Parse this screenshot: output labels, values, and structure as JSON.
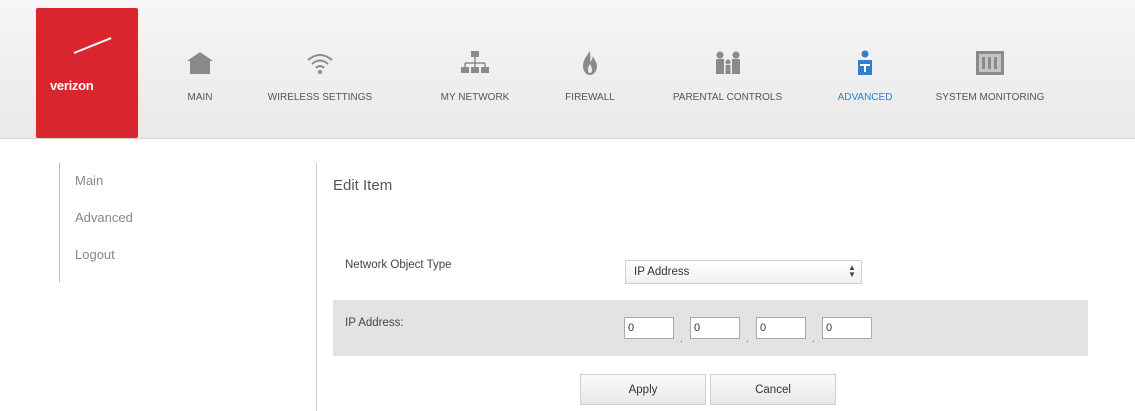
{
  "brand": {
    "logo_text": "verizon",
    "accent": "#d9262e"
  },
  "nav": {
    "active_color": "#2f7fd0",
    "items": [
      {
        "label": "MAIN",
        "icon": "home-icon"
      },
      {
        "label": "WIRELESS SETTINGS",
        "icon": "wifi-icon"
      },
      {
        "label": "MY NETWORK",
        "icon": "network-icon"
      },
      {
        "label": "FIREWALL",
        "icon": "flame-icon"
      },
      {
        "label": "PARENTAL CONTROLS",
        "icon": "family-icon"
      },
      {
        "label": "ADVANCED",
        "icon": "advanced-icon",
        "active": true
      },
      {
        "label": "SYSTEM MONITORING",
        "icon": "monitor-icon"
      }
    ]
  },
  "sidebar": {
    "items": [
      {
        "label": "Main"
      },
      {
        "label": "Advanced"
      },
      {
        "label": "Logout"
      }
    ]
  },
  "form": {
    "title": "Edit Item",
    "type_label": "Network Object Type",
    "type_value": "IP Address",
    "ip_label": "IP Address:",
    "ip_octets": [
      "0",
      "0",
      "0",
      "0"
    ],
    "apply_label": "Apply",
    "cancel_label": "Cancel"
  }
}
